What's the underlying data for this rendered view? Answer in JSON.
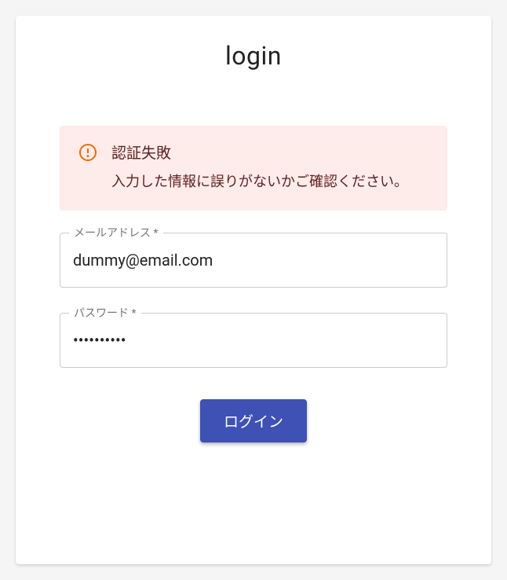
{
  "title": "login",
  "alert": {
    "title": "認証失敗",
    "message": "入力した情報に誤りがないかご確認ください。"
  },
  "fields": {
    "email": {
      "label": "メールアドレス *",
      "value": "dummy@email.com"
    },
    "password": {
      "label": "パスワード *",
      "value": "••••••••••"
    }
  },
  "buttons": {
    "login": "ログイン"
  },
  "colors": {
    "primary": "#3f51b5",
    "alertBg": "#fdecea",
    "alertText": "#5f2120",
    "alertIcon": "#ef6c00"
  }
}
